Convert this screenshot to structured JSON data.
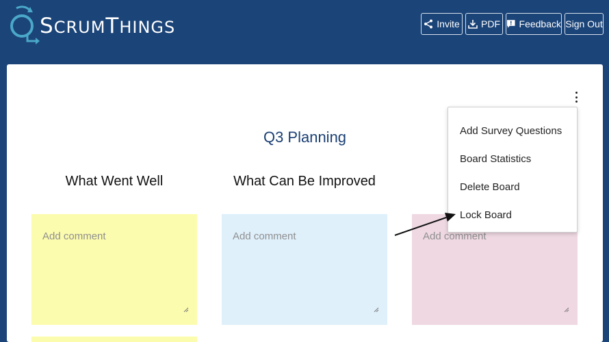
{
  "header": {
    "brand_first": "S",
    "brand_rest_a": "CRUM",
    "brand_mid": "T",
    "brand_rest_b": "HINGS",
    "buttons": {
      "invite": "Invite",
      "pdf": "PDF",
      "feedback": "Feedback",
      "signout": "Sign Out"
    }
  },
  "board": {
    "title": "Q3 Planning",
    "columns": [
      {
        "title": "What Went Well",
        "placeholder": "Add comment",
        "color": "#fcfcae"
      },
      {
        "title": "What Can Be Improved",
        "placeholder": "Add comment",
        "color": "#dff0fb"
      },
      {
        "title": "",
        "placeholder": "Add comment",
        "color": "#efd8e2"
      }
    ]
  },
  "menu": {
    "items": [
      "Add Survey Questions",
      "Board Statistics",
      "Delete Board",
      "Lock Board"
    ]
  },
  "icons": {
    "invite": "share-icon",
    "pdf": "download-icon",
    "feedback": "feedback-icon",
    "more": "kebab-icon",
    "logo": "scrumthings-logo-icon"
  },
  "colors": {
    "header_bg": "#1b4478",
    "title": "#1b3f73",
    "logo": "#4aa8c9"
  }
}
